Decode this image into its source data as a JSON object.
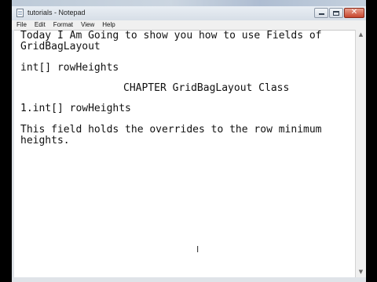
{
  "window": {
    "title": "tutorials - Notepad",
    "controls": {
      "minimize": "",
      "maximize": "",
      "close": "✕"
    }
  },
  "menu": [
    "File",
    "Edit",
    "Format",
    "View",
    "Help"
  ],
  "editor": {
    "lines": [
      "Today I Am Going to show you how to use Fields of",
      "GridBagLayout",
      "int[] rowHeights",
      "CHAPTER GridBagLayout Class",
      "1.int[] rowHeights",
      "This field holds the overrides to the row minimum",
      "heights."
    ]
  },
  "scrollbar": {
    "up": "▲",
    "down": "▼"
  },
  "cursor_glyph": "I"
}
